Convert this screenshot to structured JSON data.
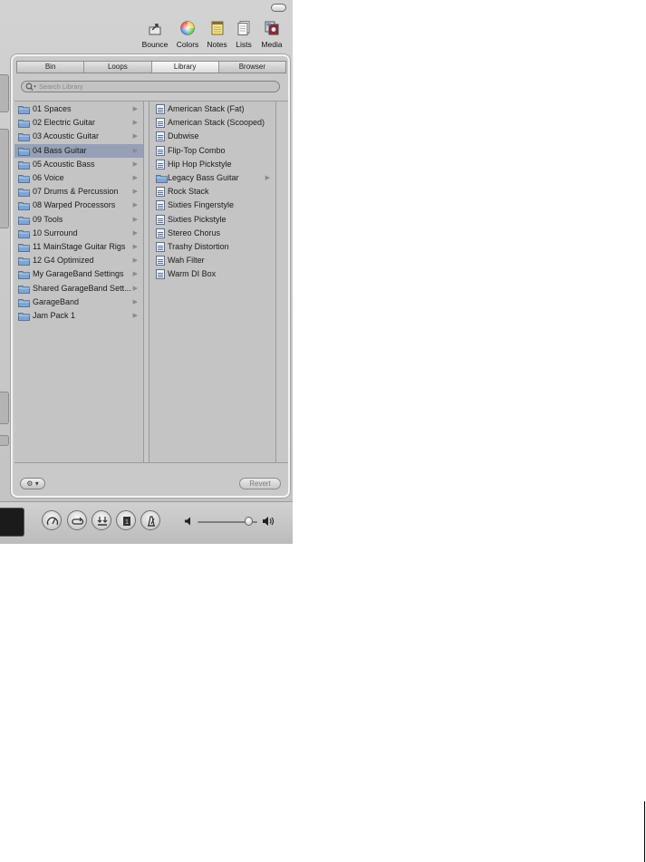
{
  "toolbar": {
    "buttons": [
      {
        "label": "Bounce",
        "icon": "bounce-icon"
      },
      {
        "label": "Colors",
        "icon": "colors-icon"
      },
      {
        "label": "Notes",
        "icon": "notes-icon"
      },
      {
        "label": "Lists",
        "icon": "lists-icon"
      },
      {
        "label": "Media",
        "icon": "media-icon"
      }
    ]
  },
  "tabs": [
    {
      "label": "Bin",
      "active": false
    },
    {
      "label": "Loops",
      "active": false
    },
    {
      "label": "Library",
      "active": true
    },
    {
      "label": "Browser",
      "active": false
    }
  ],
  "search": {
    "placeholder": "Search Library"
  },
  "library_folders": [
    {
      "label": "01 Spaces",
      "selected": false
    },
    {
      "label": "02 Electric Guitar",
      "selected": false
    },
    {
      "label": "03 Acoustic Guitar",
      "selected": false
    },
    {
      "label": "04 Bass Guitar",
      "selected": true
    },
    {
      "label": "05 Acoustic Bass",
      "selected": false
    },
    {
      "label": "06 Voice",
      "selected": false
    },
    {
      "label": "07 Drums & Percussion",
      "selected": false
    },
    {
      "label": "08 Warped Processors",
      "selected": false
    },
    {
      "label": "09 Tools",
      "selected": false
    },
    {
      "label": "10 Surround",
      "selected": false
    },
    {
      "label": "11 MainStage Guitar Rigs",
      "selected": false
    },
    {
      "label": "12 G4 Optimized",
      "selected": false
    },
    {
      "label": "My GarageBand Settings",
      "selected": false
    },
    {
      "label": "Shared GarageBand Sett...",
      "selected": false
    },
    {
      "label": "GarageBand",
      "selected": false
    },
    {
      "label": "Jam Pack 1",
      "selected": false
    }
  ],
  "bass_guitar_items": [
    {
      "label": "American Stack (Fat)",
      "kind": "patch"
    },
    {
      "label": "American Stack (Scooped)",
      "kind": "patch"
    },
    {
      "label": "Dubwise",
      "kind": "patch"
    },
    {
      "label": "Flip-Top Combo",
      "kind": "patch"
    },
    {
      "label": "Hip Hop Pickstyle",
      "kind": "patch"
    },
    {
      "label": "Legacy Bass Guitar",
      "kind": "folder"
    },
    {
      "label": "Rock Stack",
      "kind": "patch"
    },
    {
      "label": "Sixties Fingerstyle",
      "kind": "patch"
    },
    {
      "label": "Sixties Pickstyle",
      "kind": "patch"
    },
    {
      "label": "Stereo Chorus",
      "kind": "patch"
    },
    {
      "label": "Trashy Distortion",
      "kind": "patch"
    },
    {
      "label": "Wah Filter",
      "kind": "patch"
    },
    {
      "label": "Warm DI Box",
      "kind": "patch"
    }
  ],
  "bottom": {
    "revert_label": "Revert"
  },
  "transport": {
    "buttons": [
      "tuner-icon",
      "cycle-icon",
      "merge-icon",
      "metronome-lcd-icon",
      "metronome-icon"
    ],
    "volume_level": 0.85
  },
  "colors": {
    "selection": "#96a0b6",
    "folder_blue": "#7fa6d3",
    "panel_bg": "#c9c9c9"
  }
}
